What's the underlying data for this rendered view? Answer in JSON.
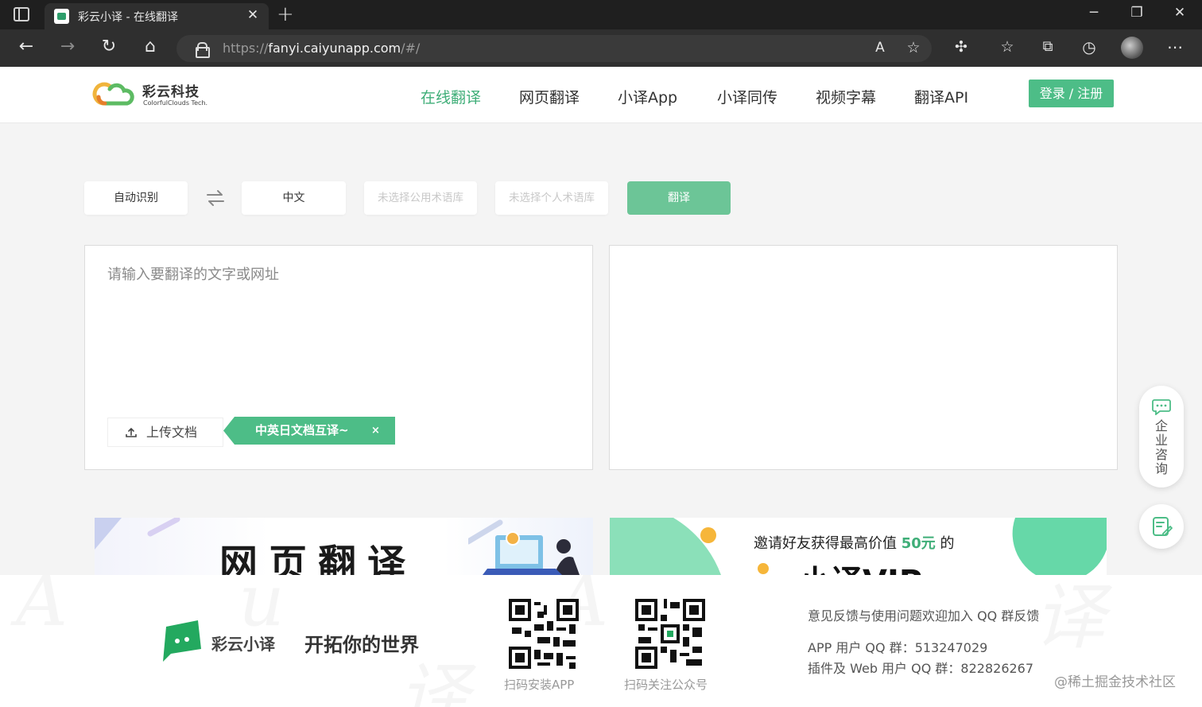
{
  "browser": {
    "tab_title": "彩云小译 - 在线翻译",
    "tab_close": "✕",
    "new_tab": "+",
    "url_prefix": "https://",
    "url_host": "fanyi.caiyunapp.com",
    "url_suffix": "/#/",
    "win_minimize": "─",
    "win_maximize": "❐",
    "win_close": "✕",
    "icons": [
      "back-icon",
      "forward-icon",
      "refresh-icon",
      "home-icon",
      "read-aloud-icon",
      "add-favorite-icon",
      "extensions-icon",
      "favorites-icon",
      "collections-icon",
      "history-icon",
      "profile-avatar",
      "more-icon"
    ]
  },
  "header": {
    "logo_name": "彩云科技",
    "logo_sub": "ColorfulClouds Tech.",
    "menu": [
      {
        "label": "在线翻译",
        "active": true
      },
      {
        "label": "网页翻译",
        "active": false
      },
      {
        "label": "小译App",
        "active": false
      },
      {
        "label": "小译同传",
        "active": false
      },
      {
        "label": "视频字幕",
        "active": false
      },
      {
        "label": "翻译API",
        "active": false
      }
    ],
    "login_label": "登录 / 注册"
  },
  "toolbar": {
    "source_lang": "自动识别",
    "target_lang": "中文",
    "public_glossary": "未选择公用术语库",
    "personal_glossary": "未选择个人术语库",
    "translate_label": "翻译"
  },
  "input": {
    "placeholder": "请输入要翻译的文字或网址",
    "upload_label": "上传文档",
    "promo_label": "中英日文档互译~",
    "promo_close": "×"
  },
  "sidebar_float": {
    "consult_label": "企业咨询"
  },
  "banners": {
    "left_title": "网页翻译",
    "right_text_before": "邀请好友获得最高价值 ",
    "right_text_highlight": "50元",
    "right_text_after": " 的",
    "right_sub": "小译VIP"
  },
  "footer": {
    "brand": "彩云小译",
    "slogan": "开拓你的世界",
    "qr_app_caption": "扫码安装APP",
    "qr_wechat_caption": "扫码关注公众号",
    "feedback_title": "意见反馈与使用问题欢迎加入 QQ 群反馈",
    "qq_app": "APP 用户 QQ 群：513247029",
    "qq_web": "插件及 Web 用户 QQ 群：822826267",
    "credit": "@稀土掘金技术社区"
  },
  "colors": {
    "accent": "#4dbd87",
    "accent_text": "#3fae78",
    "chrome_dark": "#1f1f1f",
    "chrome_toolbar": "#2f2f2f"
  }
}
